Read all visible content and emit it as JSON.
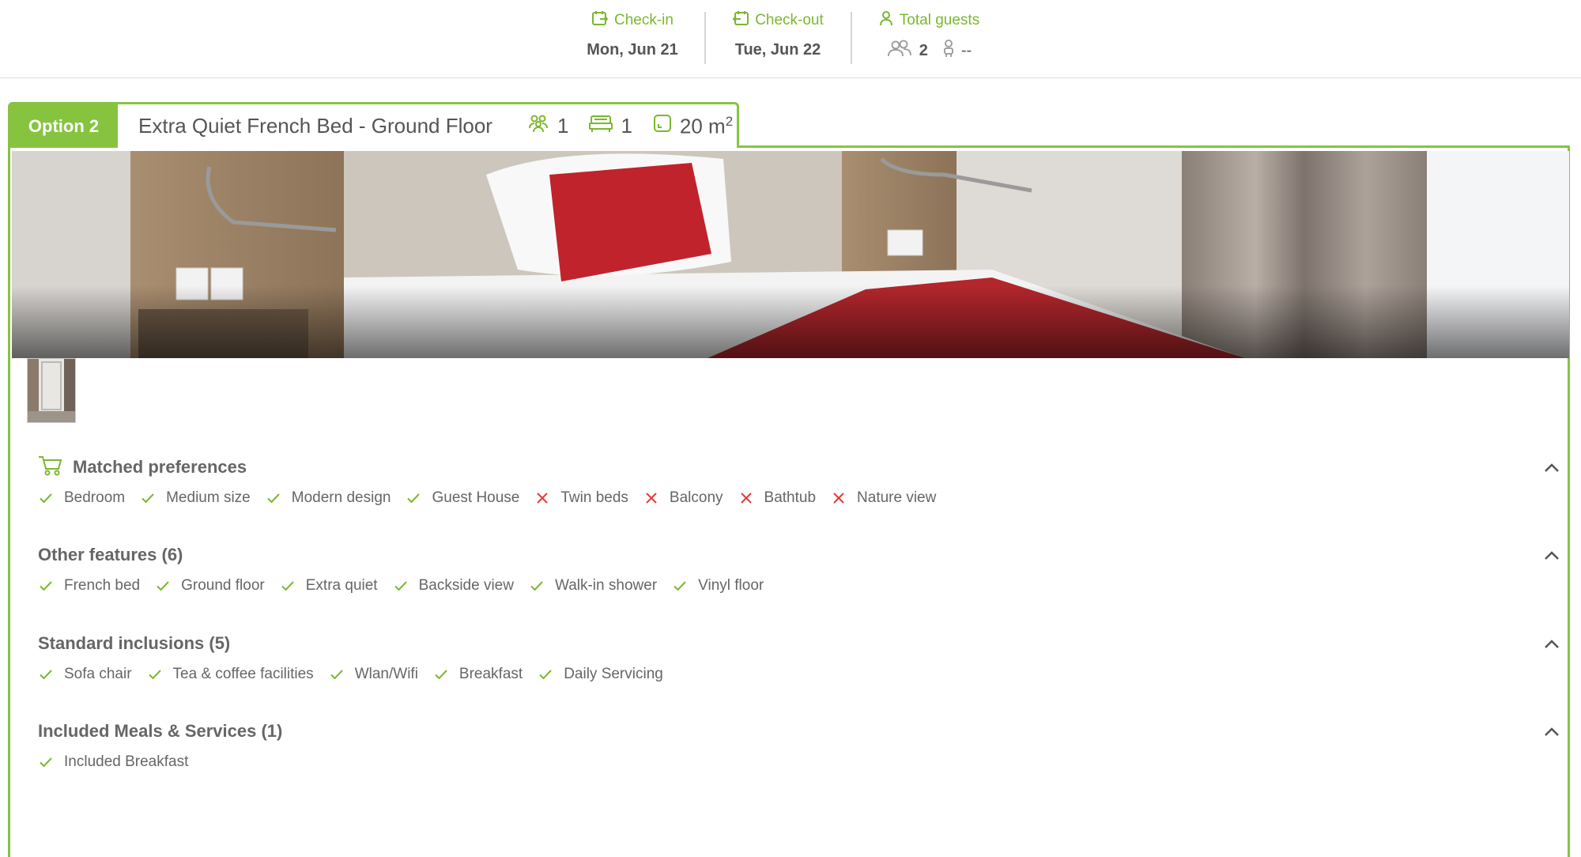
{
  "header": {
    "checkin_label": "Check-in",
    "checkin_value": "Mon, Jun 21",
    "checkout_label": "Check-out",
    "checkout_value": "Tue, Jun 22",
    "guests_label": "Total guests",
    "adults": "2",
    "children": "--"
  },
  "room": {
    "option_label": "Option 2",
    "name": "Extra Quiet French Bed - Ground Floor",
    "guests": "1",
    "beds": "1",
    "size": "20 m",
    "size_unit_sup": "2"
  },
  "sections": [
    {
      "title": "Matched preferences",
      "icon": "cart-icon",
      "items": [
        {
          "label": "Bedroom",
          "ok": true
        },
        {
          "label": "Medium size",
          "ok": true
        },
        {
          "label": "Modern design",
          "ok": true
        },
        {
          "label": "Guest House",
          "ok": true
        },
        {
          "label": "Twin beds",
          "ok": false
        },
        {
          "label": "Balcony",
          "ok": false
        },
        {
          "label": "Bathtub",
          "ok": false
        },
        {
          "label": "Nature view",
          "ok": false
        }
      ]
    },
    {
      "title": "Other features (6)",
      "items": [
        {
          "label": "French bed",
          "ok": true
        },
        {
          "label": "Ground floor",
          "ok": true
        },
        {
          "label": "Extra quiet",
          "ok": true
        },
        {
          "label": "Backside view",
          "ok": true
        },
        {
          "label": "Walk-in shower",
          "ok": true
        },
        {
          "label": "Vinyl floor",
          "ok": true
        }
      ]
    },
    {
      "title": "Standard inclusions (5)",
      "items": [
        {
          "label": "Sofa chair",
          "ok": true
        },
        {
          "label": "Tea & coffee facilities",
          "ok": true
        },
        {
          "label": "Wlan/Wifi",
          "ok": true
        },
        {
          "label": "Breakfast",
          "ok": true
        },
        {
          "label": "Daily Servicing",
          "ok": true
        }
      ]
    },
    {
      "title": "Included Meals & Services (1)",
      "items": [
        {
          "label": "Included Breakfast",
          "ok": true
        }
      ]
    }
  ],
  "colors": {
    "accent": "#86c440",
    "label_green": "#7ab82e",
    "check": "#7ab82e",
    "cross": "#e53935"
  }
}
